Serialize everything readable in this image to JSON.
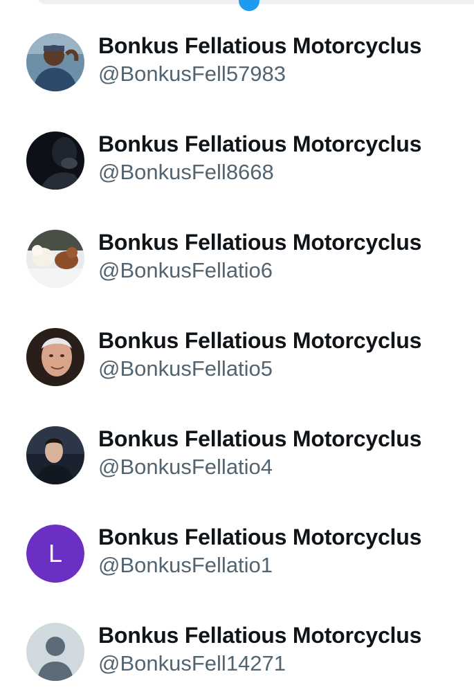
{
  "users": [
    {
      "name": "Bonkus Fellatious Motorcyclus",
      "handle": "@BonkusFell57983",
      "avatar": "photo-man-headband"
    },
    {
      "name": "Bonkus Fellatious Motorcyclus",
      "handle": "@BonkusFell8668",
      "avatar": "photo-dark"
    },
    {
      "name": "Bonkus Fellatious Motorcyclus",
      "handle": "@BonkusFellatio6",
      "avatar": "photo-dogs-snow"
    },
    {
      "name": "Bonkus Fellatious Motorcyclus",
      "handle": "@BonkusFellatio5",
      "avatar": "photo-grey-hair-man"
    },
    {
      "name": "Bonkus Fellatious Motorcyclus",
      "handle": "@BonkusFellatio4",
      "avatar": "photo-man-dark-bg"
    },
    {
      "name": "Bonkus Fellatious Motorcyclus",
      "handle": "@BonkusFellatio1",
      "avatar": "letter",
      "avatar_letter": "L",
      "avatar_color": "#6b2fc4"
    },
    {
      "name": "Bonkus Fellatious Motorcyclus",
      "handle": "@BonkusFell14271",
      "avatar": "default-person-icon"
    }
  ],
  "colors": {
    "name": "#0f1419",
    "handle": "#536471",
    "accent": "#1d9bf0"
  }
}
